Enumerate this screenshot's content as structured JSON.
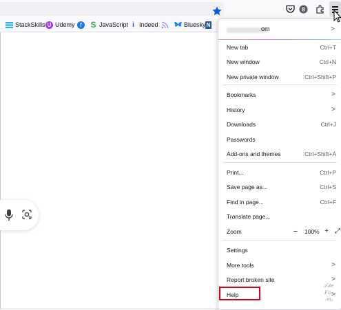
{
  "bookmarks": [
    {
      "label": "StackSkills",
      "icon": "stackskills-icon",
      "color": "#2bb3e6"
    },
    {
      "label": "Udemy",
      "icon": "udemy-icon",
      "color": "#a435f0"
    },
    {
      "label": "",
      "icon": "facebook-icon",
      "color": "#1877f2"
    },
    {
      "label": "JavaScript",
      "icon": "javascript-icon",
      "color": "#3ba55c"
    },
    {
      "label": "Indeed",
      "icon": "indeed-icon",
      "color": "#2557a7"
    },
    {
      "label": "",
      "icon": "rss-icon",
      "color": "#a78bfa"
    },
    {
      "label": "Bluesky",
      "icon": "bluesky-icon",
      "color": "#1185fe"
    },
    {
      "label": "N",
      "icon": "n-icon",
      "color": "#2557a7"
    }
  ],
  "menu": {
    "account_suffix": "om",
    "items": {
      "new_tab": {
        "label": "New tab",
        "shortcut": "Ctrl+T"
      },
      "new_window": {
        "label": "New window",
        "shortcut": "Ctrl+N"
      },
      "new_private_window": {
        "label": "New private window",
        "shortcut": "Ctrl+Shift+P"
      },
      "bookmarks": {
        "label": "Bookmarks"
      },
      "history": {
        "label": "History"
      },
      "downloads": {
        "label": "Downloads",
        "shortcut": "Ctrl+J"
      },
      "passwords": {
        "label": "Passwords"
      },
      "addons": {
        "label": "Add-ons and themes",
        "shortcut": "Ctrl+Shift+A"
      },
      "print": {
        "label": "Print...",
        "shortcut": "Ctrl+P"
      },
      "save_page": {
        "label": "Save page as...",
        "shortcut": "Ctrl+S"
      },
      "find": {
        "label": "Find in page...",
        "shortcut": "Ctrl+F"
      },
      "translate": {
        "label": "Translate page..."
      },
      "zoom": {
        "label": "Zoom",
        "minus": "−",
        "value": "100%",
        "plus": "+",
        "fullscreen": "⤢"
      },
      "settings": {
        "label": "Settings"
      },
      "more_tools": {
        "label": "More tools"
      },
      "report": {
        "label": "Report broken site"
      },
      "help": {
        "label": "Help"
      }
    }
  },
  "colors": {
    "accent_blue": "#0060df",
    "highlight_red": "#e00018"
  }
}
